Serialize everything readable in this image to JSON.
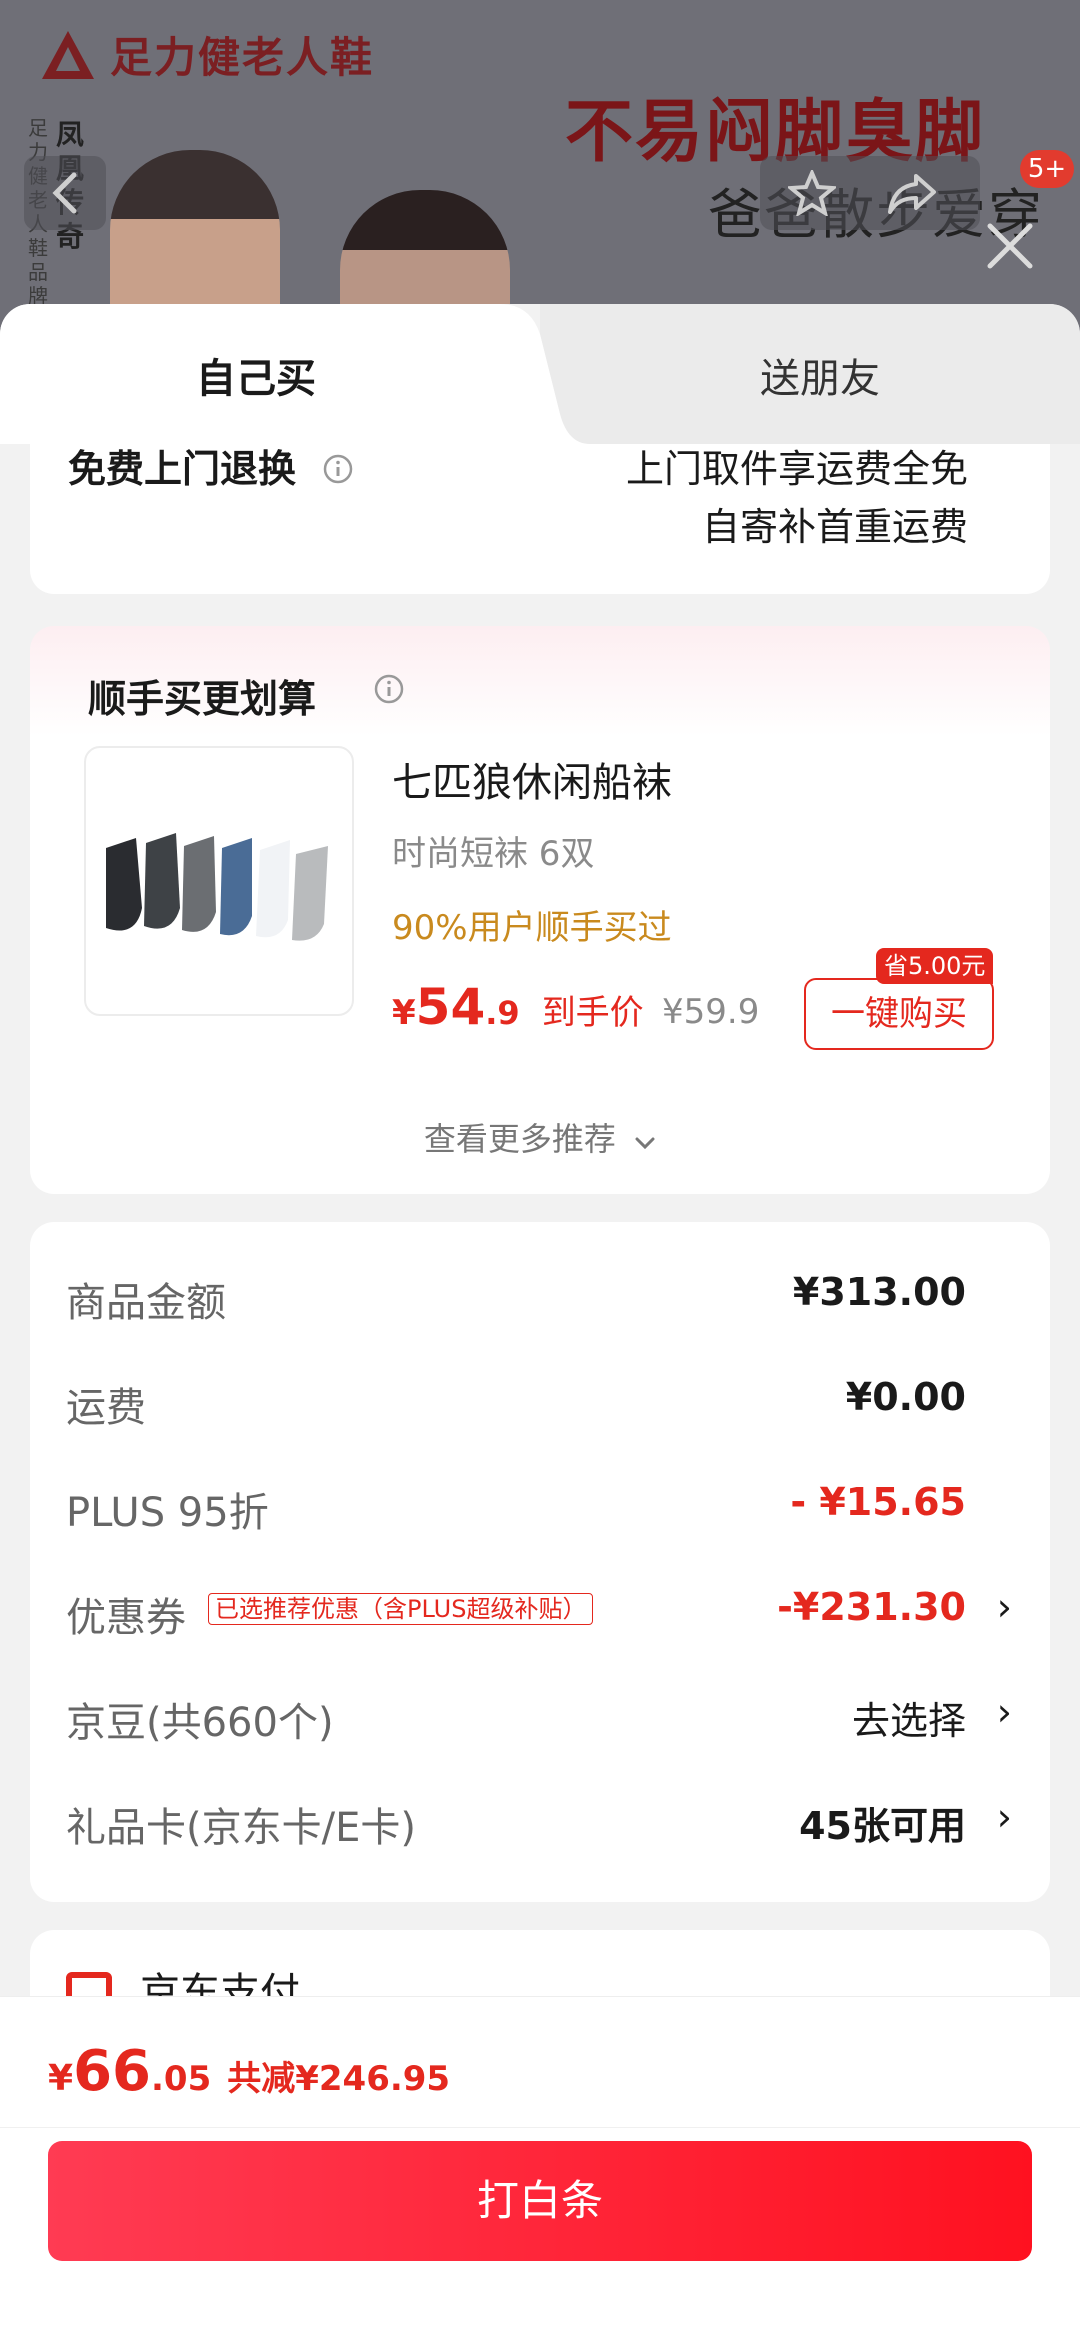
{
  "banner": {
    "brand_name": "足力健老人鞋",
    "vertical_brand": "足力健老人鞋品牌代",
    "vertical_name": "凤凰传奇",
    "slogan_main": "不易闷脚臭脚",
    "slogan_sub": "爸爸散步爱穿",
    "badge_count": "5+"
  },
  "tabs": [
    {
      "label": "自己买",
      "active": true
    },
    {
      "label": "送朋友",
      "active": false
    }
  ],
  "return_policy": {
    "title": "免费上门退换",
    "line1": "上门取件享运费全免",
    "line2": "自寄补首重运费"
  },
  "recommend": {
    "title": "顺手买更划算",
    "product": {
      "name": "七匹狼休闲船袜",
      "spec": "时尚短袜 6双",
      "social": "90%用户顺手买过",
      "price_currency": "¥",
      "price_int": "54",
      "price_dec": ".9",
      "price_tag": "到手价",
      "original_price": "¥59.9",
      "buy_label": "一键购买",
      "save_badge": "省5.00元"
    },
    "more_label": "查看更多推荐"
  },
  "summary": {
    "rows": [
      {
        "label": "商品金额",
        "value": "¥313.00"
      },
      {
        "label": "运费",
        "value": "¥0.00"
      },
      {
        "label": "PLUS 95折",
        "value": "- ¥15.65"
      },
      {
        "label": "优惠券",
        "tag": "已选推荐优惠（含PLUS超级补贴）",
        "value": "-¥231.30"
      },
      {
        "label": "京豆(共660个)",
        "value": "去选择"
      },
      {
        "label": "礼品卡(京东卡/E卡)",
        "value": "45张可用"
      }
    ]
  },
  "payment": {
    "label": "京东支付"
  },
  "bottom": {
    "total_currency": "¥",
    "total_int": "66",
    "total_dec": ".05",
    "total_save": "共减¥246.95",
    "pay_button": "打白条"
  },
  "colors": {
    "accent": "#e4281e",
    "button_gradient_start": "#ff3b53",
    "button_gradient_end": "#ff1120"
  }
}
